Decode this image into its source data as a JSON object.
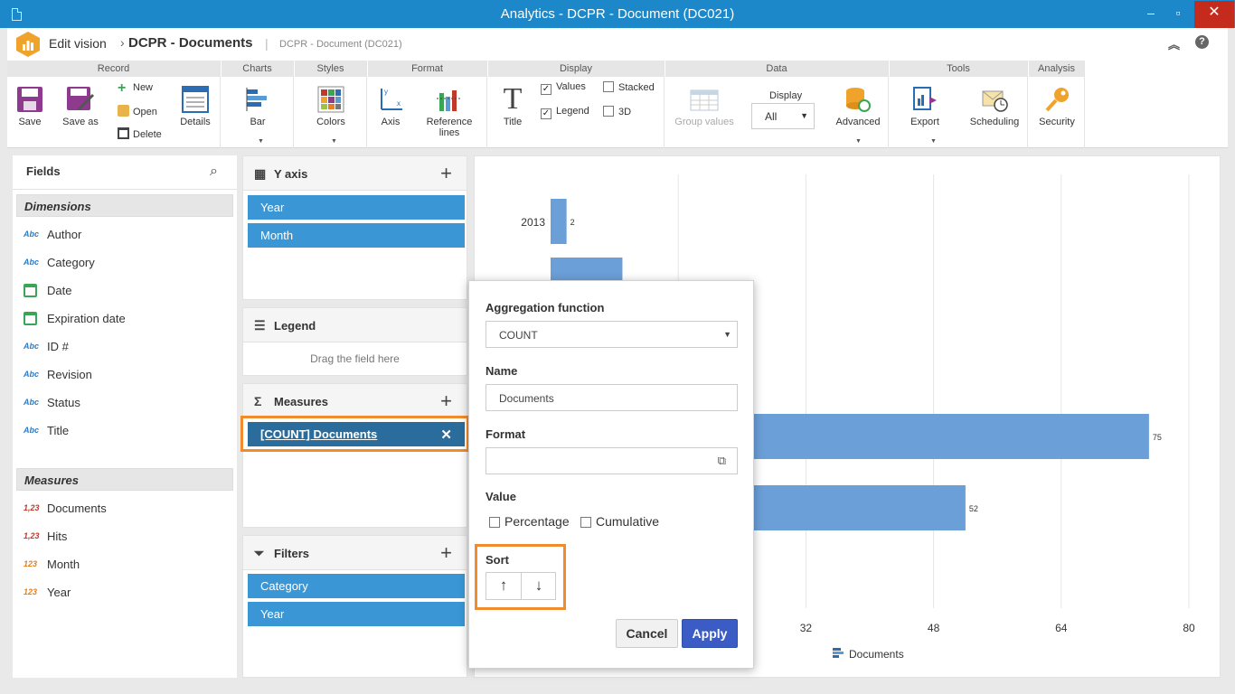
{
  "window": {
    "title": "Analytics - DCPR - Document (DC021)"
  },
  "appbar": {
    "edit_vision": "Edit vision",
    "doc_title": "DCPR - Documents",
    "doc_sub": "DCPR - Document (DC021)"
  },
  "ribbon": {
    "groups": {
      "record": "Record",
      "charts": "Charts",
      "styles": "Styles",
      "format": "Format",
      "display": "Display",
      "data": "Data",
      "tools": "Tools",
      "analysis": "Analysis"
    },
    "save": "Save",
    "save_as": "Save as",
    "new": "New",
    "open": "Open",
    "delete": "Delete",
    "details": "Details",
    "bar": "Bar",
    "colors": "Colors",
    "axis": "Axis",
    "reference_lines_1": "Reference",
    "reference_lines_2": "lines",
    "title": "Title",
    "values": "Values",
    "legend": "Legend",
    "stacked": "Stacked",
    "three_d": "3D",
    "group_values": "Group values",
    "display_label": "Display",
    "display_value": "All",
    "advanced": "Advanced",
    "export": "Export",
    "scheduling": "Scheduling",
    "security": "Security",
    "values_checked": true,
    "legend_checked": true,
    "stacked_checked": false,
    "three_d_checked": false
  },
  "fields": {
    "header": "Fields",
    "dimensions_header": "Dimensions",
    "dimensions": [
      {
        "icon": "Abc",
        "label": "Author"
      },
      {
        "icon": "Abc",
        "label": "Category"
      },
      {
        "icon": "calendar",
        "label": "Date"
      },
      {
        "icon": "calendar",
        "label": "Expiration date"
      },
      {
        "icon": "Abc",
        "label": "ID #"
      },
      {
        "icon": "Abc",
        "label": "Revision"
      },
      {
        "icon": "Abc",
        "label": "Status"
      },
      {
        "icon": "Abc",
        "label": "Title"
      }
    ],
    "measures_header": "Measures",
    "measures": [
      {
        "icon": "1,23",
        "label": "Documents"
      },
      {
        "icon": "1,23",
        "label": "Hits"
      },
      {
        "icon": "123",
        "label": "Month"
      },
      {
        "icon": "123",
        "label": "Year"
      }
    ]
  },
  "yaxis": {
    "title": "Y axis",
    "items": [
      "Year",
      "Month"
    ]
  },
  "legend_box": {
    "title": "Legend",
    "placeholder": "Drag the field here"
  },
  "measures_box": {
    "title": "Measures",
    "item": "[COUNT] Documents"
  },
  "filters_box": {
    "title": "Filters",
    "items": [
      "Category",
      "Year"
    ]
  },
  "chart_data": {
    "type": "bar",
    "orientation": "horizontal",
    "categories": [
      "2013",
      "",
      "",
      "",
      ""
    ],
    "visible_labels": [
      {
        "category": "2013",
        "value": "2"
      },
      {
        "value": "75"
      },
      {
        "value": "52"
      }
    ],
    "x_ticks": [
      "32",
      "48",
      "64",
      "80"
    ],
    "xlim": [
      0,
      80
    ],
    "legend": "Documents",
    "bar_color": "#6a9fd8"
  },
  "popup": {
    "aggregation_label": "Aggregation function",
    "aggregation_value": "COUNT",
    "name_label": "Name",
    "name_value": "Documents",
    "format_label": "Format",
    "format_value": "",
    "value_label": "Value",
    "percentage": "Percentage",
    "cumulative": "Cumulative",
    "sort_label": "Sort",
    "cancel": "Cancel",
    "apply": "Apply"
  },
  "colors": {
    "titlebar": "#1c87c9",
    "chip": "#3a96d4",
    "chip_dark": "#2a6d9c",
    "highlight": "#f08c2e",
    "apply": "#3b5cc4"
  }
}
